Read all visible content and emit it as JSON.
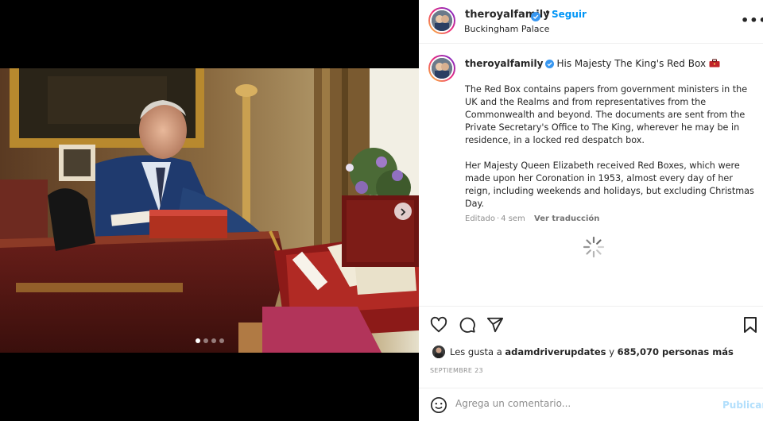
{
  "header": {
    "username": "theroyalfamily",
    "separator": "•",
    "follow_label": "Seguir",
    "location": "Buckingham Palace",
    "more_label": "•••"
  },
  "caption": {
    "username": "theroyalfamily",
    "title": "His Majesty The King's Red Box",
    "paragraph1": "The Red Box contains papers from government ministers in the UK and the Realms and from representatives from the Commonwealth and beyond. The documents are sent from the Private Secretary's Office to The King, wherever he may be in residence, in a locked red despatch box.",
    "paragraph2": "Her Majesty Queen Elizabeth received Red Boxes, which were made upon her Coronation in 1953, almost every day of her reign, including weekends and holidays, but excluding Christmas Day.",
    "edited_label": "Editado",
    "age": "4 sem",
    "translate_label": "Ver traducción"
  },
  "likes": {
    "prefix": "Les gusta a",
    "liker": "adamdriverupdates",
    "connector": "y",
    "others": "685,070 personas más"
  },
  "post_date": "SEPTIEMBRE 23",
  "comment": {
    "placeholder": "Agrega un comentario...",
    "publish_label": "Publicar"
  },
  "carousel": {
    "total": 4,
    "active_index": 0
  },
  "colors": {
    "link_blue": "#0095f6",
    "publish_disabled": "#b2dffc",
    "verified_blue": "#3897f0",
    "secondary_text": "#8e8e8e"
  },
  "icons": [
    "verified-badge-icon",
    "more-options-icon",
    "red-box-emoji-icon",
    "loading-spinner-icon",
    "heart-icon",
    "comment-icon",
    "share-icon",
    "bookmark-icon",
    "emoji-icon",
    "chevron-right-icon"
  ]
}
